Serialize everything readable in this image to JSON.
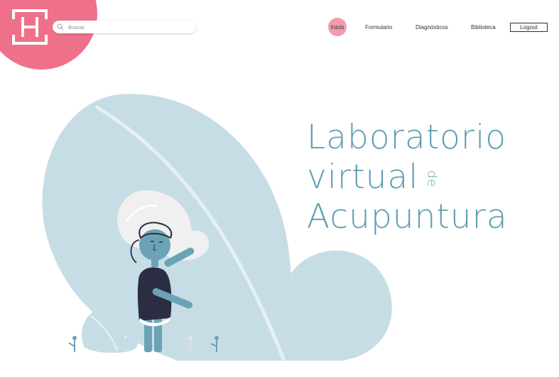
{
  "header": {
    "search": {
      "placeholder": "Buscar",
      "value": ""
    },
    "nav": {
      "items": [
        {
          "label": "Inicio",
          "active": true
        },
        {
          "label": "Formulario"
        },
        {
          "label": "Diagnósticos"
        },
        {
          "label": "Biblioteca"
        }
      ],
      "logout_label": "Logout"
    }
  },
  "hero": {
    "line1": "Laboratorio",
    "line2": "virtual",
    "connector": "de",
    "line3": "Acupuntura"
  },
  "colors": {
    "brand_pink": "#ef7189",
    "active_pink": "#f39bad",
    "title_teal": "#5f9eb2",
    "leaf_blue": "#c7dde5",
    "character_teal": "#6aa3b6",
    "character_navy": "#2b2d42"
  }
}
